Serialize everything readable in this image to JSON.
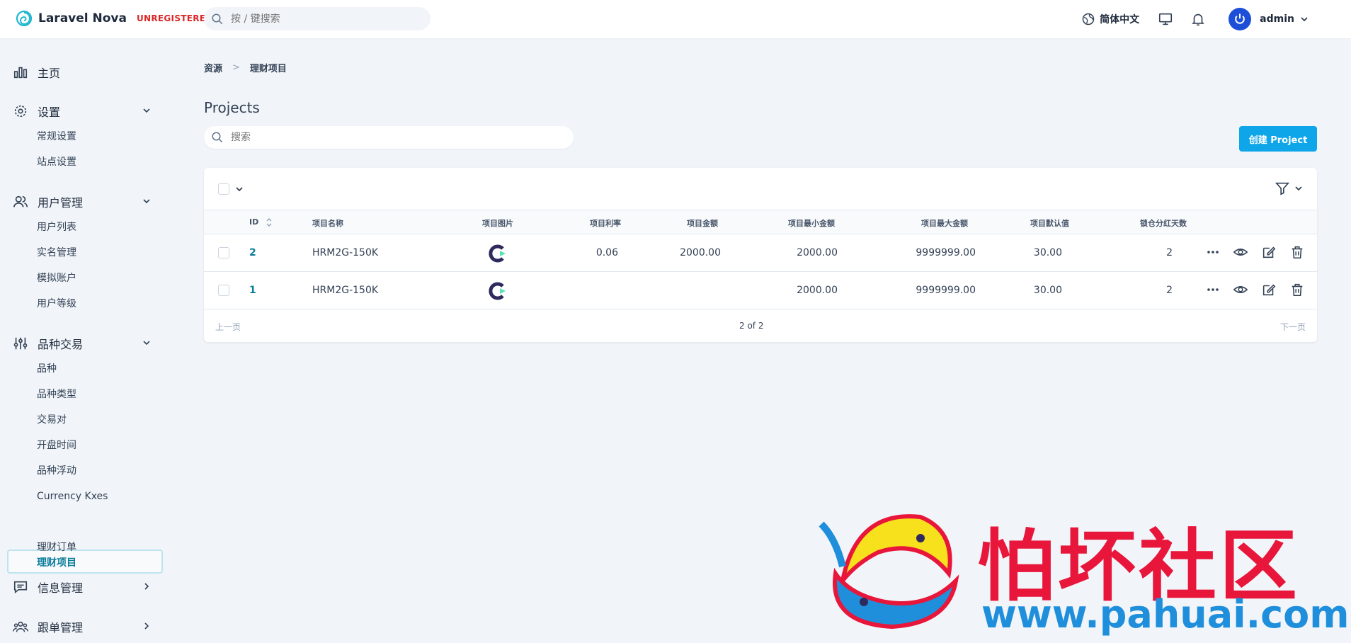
{
  "header": {
    "app_name": "Laravel Nova",
    "badge": "UNREGISTERED",
    "search_placeholder": "按 / 键搜索",
    "language": "简体中文",
    "user_name": "admin"
  },
  "sidebar": {
    "home": "主页",
    "settings": {
      "label": "设置",
      "items": [
        "常规设置",
        "站点设置"
      ]
    },
    "users": {
      "label": "用户管理",
      "items": [
        "用户列表",
        "实名管理",
        "模拟账户",
        "用户等级"
      ]
    },
    "trading": {
      "label": "品种交易",
      "items": [
        "品种",
        "品种类型",
        "交易对",
        "开盘时间",
        "品种浮动",
        "Currency Kxes",
        "理财项目",
        "理财订单"
      ]
    },
    "messages": {
      "label": "信息管理"
    },
    "follow": {
      "label": "跟单管理"
    }
  },
  "breadcrumb": {
    "root": "资源",
    "current": "理财项目"
  },
  "page": {
    "title": "Projects",
    "search_placeholder": "搜索",
    "create_label": "创建 Project"
  },
  "table": {
    "headers": {
      "id": "ID",
      "name": "项目名称",
      "image": "项目图片",
      "rate": "项目利率",
      "amount": "项目金额",
      "min": "项目最小金额",
      "max": "项目最大金额",
      "default": "项目默认值",
      "days": "锁仓分红天数"
    },
    "rows": [
      {
        "id": "2",
        "name": "HRM2G-150K",
        "rate": "0.06",
        "amount": "2000.00",
        "min": "2000.00",
        "max": "9999999.00",
        "default": "30.00",
        "days": "2"
      },
      {
        "id": "1",
        "name": "HRM2G-150K",
        "rate": "",
        "amount": "",
        "min": "2000.00",
        "max": "9999999.00",
        "default": "30.00",
        "days": "2"
      }
    ]
  },
  "pagination": {
    "prev": "上一页",
    "info": "2 of 2",
    "next": "下一页"
  },
  "watermark": {
    "title": "怕坏社区",
    "url": "www.pahuai.com"
  },
  "colors": {
    "accent": "#0ea5e9",
    "link": "#0b7d9b",
    "badge": "#dc2626"
  }
}
